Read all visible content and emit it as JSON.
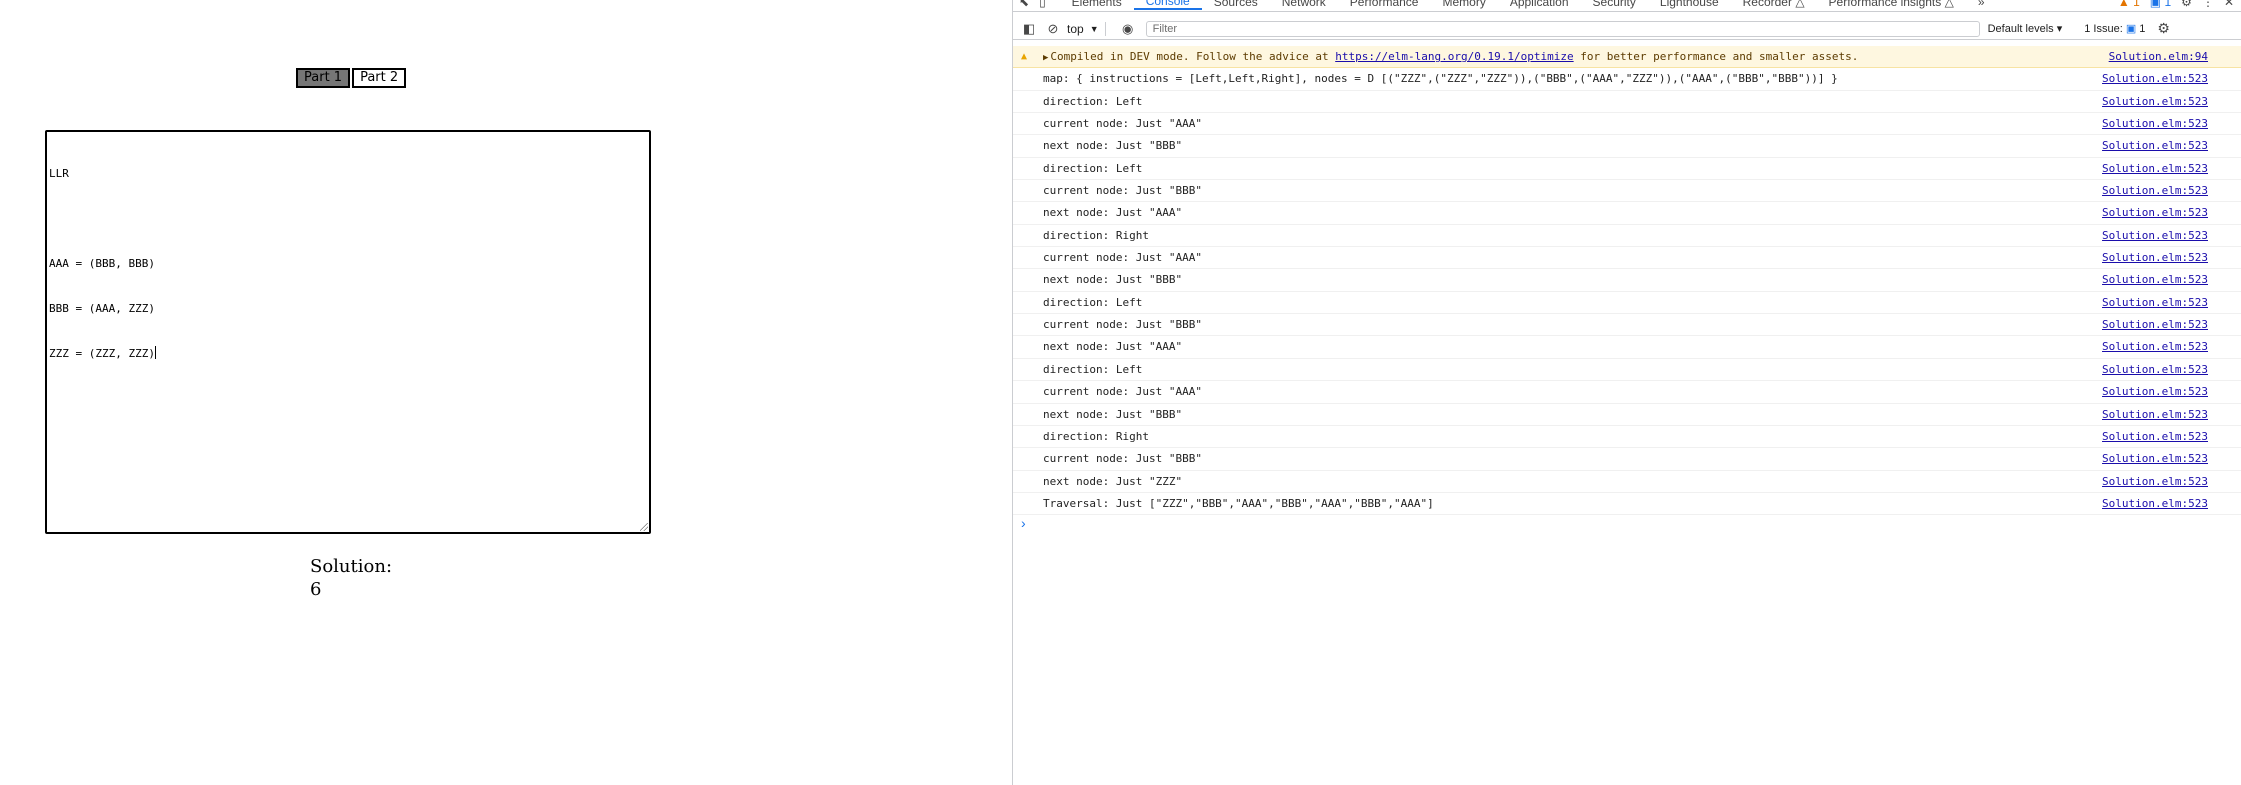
{
  "app": {
    "buttons": {
      "part1": "Part 1",
      "part2": "Part 2"
    },
    "input_lines": [
      "LLR",
      "",
      "AAA = (BBB, BBB)",
      "BBB = (AAA, ZZZ)",
      "ZZZ = (ZZZ, ZZZ)"
    ],
    "solution_label": "Solution:",
    "solution_value": "6"
  },
  "devtools": {
    "tabs": [
      "Elements",
      "Console",
      "Sources",
      "Network",
      "Performance",
      "Memory",
      "Application",
      "Security",
      "Lighthouse",
      "Recorder △",
      "Performance insights △"
    ],
    "active_tab": "Console",
    "more_tabs": "»",
    "warnings_count": "1",
    "info_count": "1",
    "toolbar": {
      "context": "top",
      "filter_placeholder": "Filter",
      "levels": "Default levels ▾",
      "issues_label": "1 Issue:",
      "issues_count": "1"
    },
    "warning": {
      "prefix": "Compiled in DEV mode. Follow the advice at ",
      "link": "https://elm-lang.org/0.19.1/optimize",
      "suffix": " for better performance and smaller assets.",
      "source": "Solution.elm:94"
    },
    "messages": [
      {
        "text": "map: { instructions = [Left,Left,Right], nodes = D [(\"ZZZ\",(\"ZZZ\",\"ZZZ\")),(\"BBB\",(\"AAA\",\"ZZZ\")),(\"AAA\",(\"BBB\",\"BBB\"))] }",
        "source": "Solution.elm:523"
      },
      {
        "text": "direction: Left",
        "source": "Solution.elm:523"
      },
      {
        "text": "current node: Just \"AAA\"",
        "source": "Solution.elm:523"
      },
      {
        "text": "next node: Just \"BBB\"",
        "source": "Solution.elm:523"
      },
      {
        "text": "direction: Left",
        "source": "Solution.elm:523"
      },
      {
        "text": "current node: Just \"BBB\"",
        "source": "Solution.elm:523"
      },
      {
        "text": "next node: Just \"AAA\"",
        "source": "Solution.elm:523"
      },
      {
        "text": "direction: Right",
        "source": "Solution.elm:523"
      },
      {
        "text": "current node: Just \"AAA\"",
        "source": "Solution.elm:523"
      },
      {
        "text": "next node: Just \"BBB\"",
        "source": "Solution.elm:523"
      },
      {
        "text": "direction: Left",
        "source": "Solution.elm:523"
      },
      {
        "text": "current node: Just \"BBB\"",
        "source": "Solution.elm:523"
      },
      {
        "text": "next node: Just \"AAA\"",
        "source": "Solution.elm:523"
      },
      {
        "text": "direction: Left",
        "source": "Solution.elm:523"
      },
      {
        "text": "current node: Just \"AAA\"",
        "source": "Solution.elm:523"
      },
      {
        "text": "next node: Just \"BBB\"",
        "source": "Solution.elm:523"
      },
      {
        "text": "direction: Right",
        "source": "Solution.elm:523"
      },
      {
        "text": "current node: Just \"BBB\"",
        "source": "Solution.elm:523"
      },
      {
        "text": "next node: Just \"ZZZ\"",
        "source": "Solution.elm:523"
      },
      {
        "text": "Traversal: Just [\"ZZZ\",\"BBB\",\"AAA\",\"BBB\",\"AAA\",\"BBB\",\"AAA\"]",
        "source": "Solution.elm:523"
      }
    ],
    "prompt_symbol": "›"
  }
}
